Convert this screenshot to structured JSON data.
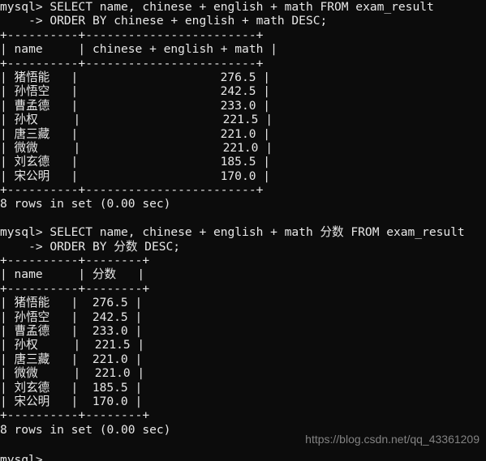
{
  "terminal": {
    "background_color": "#0c0c0c",
    "foreground_color": "#e8e8e8",
    "prompt": "mysql>",
    "continuation_prompt": "->"
  },
  "watermark": {
    "text": "https://blog.csdn.net/qq_43361209",
    "color": "#8d8d8d"
  },
  "session": {
    "blocks": [
      {
        "command_lines": [
          "mysql> SELECT name, chinese + english + math FROM exam_result",
          "    -> ORDER BY chinese + english + math DESC;"
        ],
        "table": {
          "top_border": "+----------+------------------------+",
          "header_row": "| name     | chinese + english + math |",
          "header_border": "+----------+------------------------+",
          "rows": [
            "| 猪悟能   |                    276.5 |",
            "| 孙悟空   |                    242.5 |",
            "| 曹孟德   |                    233.0 |",
            "| 孙权     |                    221.5 |",
            "| 唐三藏   |                    221.0 |",
            "| 微微     |                    221.0 |",
            "| 刘玄德   |                    185.5 |",
            "| 宋公明   |                    170.0 |"
          ],
          "bottom_border": "+----------+------------------------+",
          "columns": [
            "name",
            "chinese + english + math"
          ],
          "data": [
            {
              "name": "猪悟能",
              "value": "276.5"
            },
            {
              "name": "孙悟空",
              "value": "242.5"
            },
            {
              "name": "曹孟德",
              "value": "233.0"
            },
            {
              "name": "孙权",
              "value": "221.5"
            },
            {
              "name": "唐三藏",
              "value": "221.0"
            },
            {
              "name": "微微",
              "value": "221.0"
            },
            {
              "name": "刘玄德",
              "value": "185.5"
            },
            {
              "name": "宋公明",
              "value": "170.0"
            }
          ]
        },
        "status": "8 rows in set (0.00 sec)"
      },
      {
        "command_lines": [
          "mysql> SELECT name, chinese + english + math 分数 FROM exam_result",
          "    -> ORDER BY 分数 DESC;"
        ],
        "table": {
          "top_border": "+----------+--------+",
          "header_row": "| name     | 分数   |",
          "header_border": "+----------+--------+",
          "rows": [
            "| 猪悟能   |  276.5 |",
            "| 孙悟空   |  242.5 |",
            "| 曹孟德   |  233.0 |",
            "| 孙权     |  221.5 |",
            "| 唐三藏   |  221.0 |",
            "| 微微     |  221.0 |",
            "| 刘玄德   |  185.5 |",
            "| 宋公明   |  170.0 |"
          ],
          "bottom_border": "+----------+--------+",
          "columns": [
            "name",
            "分数"
          ],
          "data": [
            {
              "name": "猪悟能",
              "value": "276.5"
            },
            {
              "name": "孙悟空",
              "value": "242.5"
            },
            {
              "name": "曹孟德",
              "value": "233.0"
            },
            {
              "name": "孙权",
              "value": "221.5"
            },
            {
              "name": "唐三藏",
              "value": "221.0"
            },
            {
              "name": "微微",
              "value": "221.0"
            },
            {
              "name": "刘玄德",
              "value": "185.5"
            },
            {
              "name": "宋公明",
              "value": "170.0"
            }
          ]
        },
        "status": "8 rows in set (0.00 sec)"
      }
    ],
    "final_prompt": "mysql>"
  },
  "lines": [
    "mysql> SELECT name, chinese + english + math FROM exam_result",
    "    -> ORDER BY chinese + english + math DESC;",
    "+----------+------------------------+",
    "| name     | chinese + english + math |",
    "+----------+------------------------+",
    "| 猪悟能   |                    276.5 |",
    "| 孙悟空   |                    242.5 |",
    "| 曹孟德   |                    233.0 |",
    "| 孙权     |                    221.5 |",
    "| 唐三藏   |                    221.0 |",
    "| 微微     |                    221.0 |",
    "| 刘玄德   |                    185.5 |",
    "| 宋公明   |                    170.0 |",
    "+----------+------------------------+",
    "8 rows in set (0.00 sec)",
    "",
    "mysql> SELECT name, chinese + english + math 分数 FROM exam_result",
    "    -> ORDER BY 分数 DESC;",
    "+----------+--------+",
    "| name     | 分数   |",
    "+----------+--------+",
    "| 猪悟能   |  276.5 |",
    "| 孙悟空   |  242.5 |",
    "| 曹孟德   |  233.0 |",
    "| 孙权     |  221.5 |",
    "| 唐三藏   |  221.0 |",
    "| 微微     |  221.0 |",
    "| 刘玄德   |  185.5 |",
    "| 宋公明   |  170.0 |",
    "+----------+--------+",
    "8 rows in set (0.00 sec)",
    "",
    "mysql>"
  ]
}
